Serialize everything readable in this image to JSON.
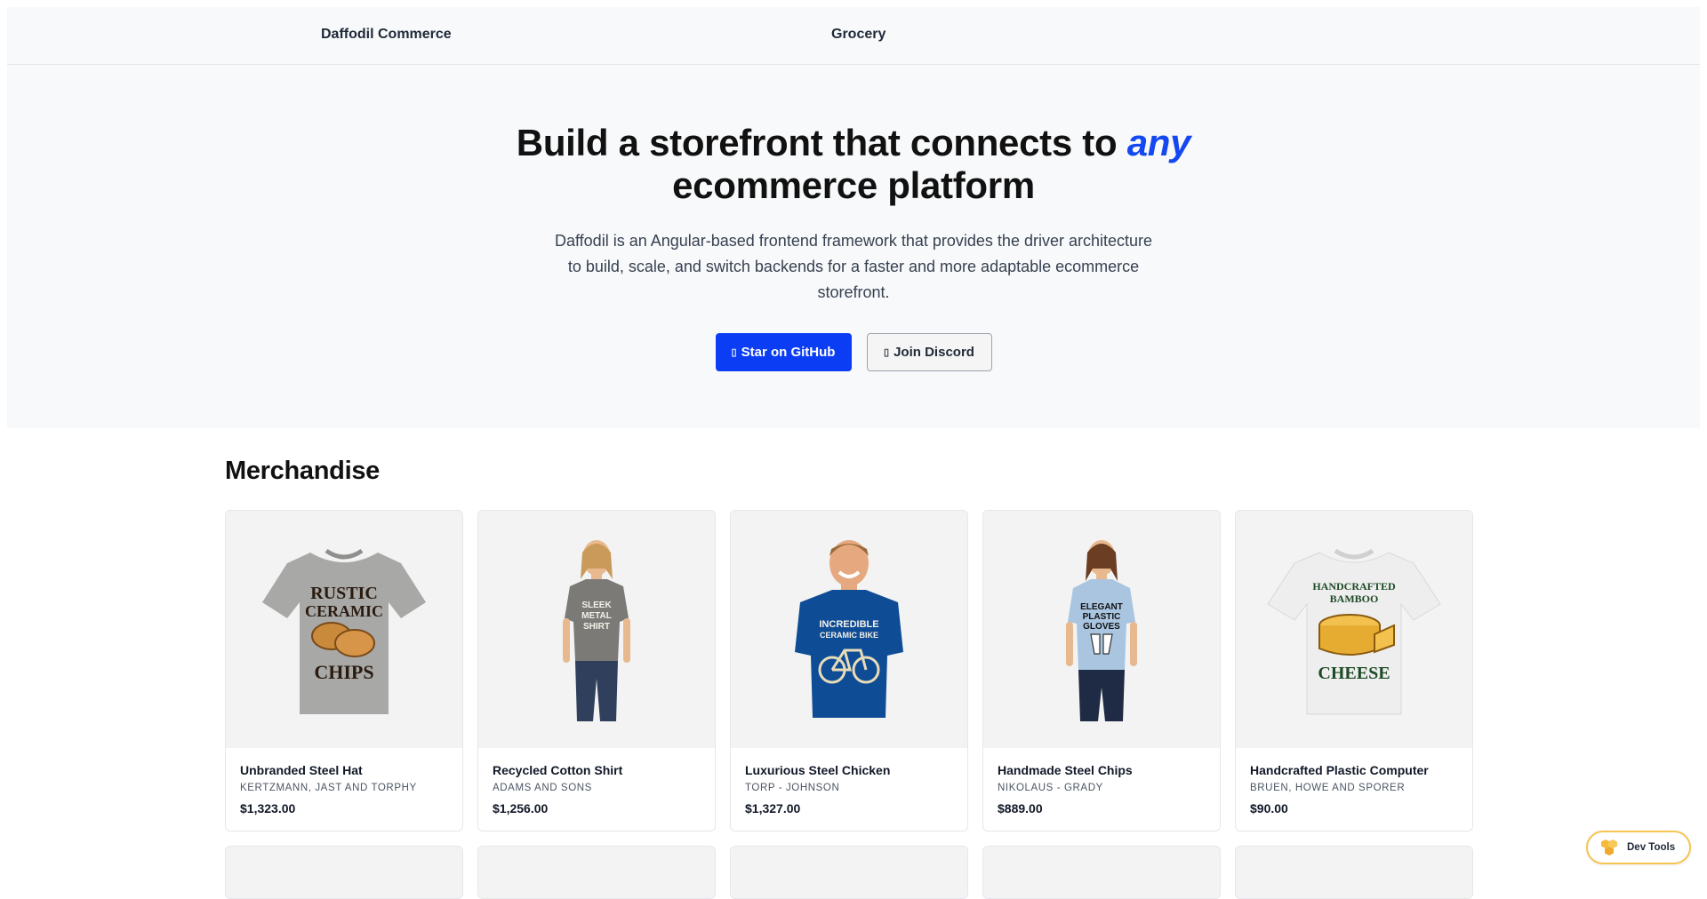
{
  "nav": {
    "brand": "Daffodil Commerce",
    "link": "Grocery"
  },
  "hero": {
    "title_part1": "Build a storefront that connects to",
    "title_accent": "any",
    "title_part2": "ecommerce platform",
    "description": "Daffodil is an Angular-based frontend framework that provides the driver architecture to build, scale, and switch backends for a faster and more adaptable ecommerce storefront.",
    "primary_button": "Star on GitHub",
    "secondary_button": "Join Discord",
    "primary_icon": "github-icon",
    "secondary_icon": "discord-icon",
    "accent_color": "#1448f0",
    "button_color": "#0b3df5"
  },
  "merchandise": {
    "heading": "Merchandise",
    "products": [
      {
        "name": "Unbranded Steel Hat",
        "brand": "KERTZMANN, JAST AND TORPHY",
        "price": "$1,323.00",
        "image": "shirt-rustic-ceramic-chips"
      },
      {
        "name": "Recycled Cotton Shirt",
        "brand": "ADAMS AND SONS",
        "price": "$1,256.00",
        "image": "woman-sleek-metal-shirt"
      },
      {
        "name": "Luxurious Steel Chicken",
        "brand": "TORP - JOHNSON",
        "price": "$1,327.00",
        "image": "man-incredible-ceramic-bike"
      },
      {
        "name": "Handmade Steel Chips",
        "brand": "NIKOLAUS - GRADY",
        "price": "$889.00",
        "image": "woman-elegant-plastic-gloves"
      },
      {
        "name": "Handcrafted Plastic Computer",
        "brand": "BRUEN, HOWE AND SPORER",
        "price": "$90.00",
        "image": "shirt-handcrafted-bamboo-cheese"
      }
    ],
    "shirt_prints": {
      "p1_line1": "RUSTIC",
      "p1_line2": "CERAMIC",
      "p1_line3": "CHIPS",
      "p2_line1": "SLEEK",
      "p2_line2": "METAL",
      "p2_line3": "SHIRT",
      "p3_line1": "INCREDIBLE",
      "p3_line2": "CERAMIC BIKE",
      "p4_line1": "ELEGANT",
      "p4_line2": "PLASTIC",
      "p4_line3": "GLOVES",
      "p5_line1": "HANDCRAFTED",
      "p5_line2": "BAMBOO",
      "p5_line3": "CHEESE"
    }
  },
  "devtools": {
    "label": "Dev Tools",
    "icon": "hexagon-cluster-icon"
  }
}
